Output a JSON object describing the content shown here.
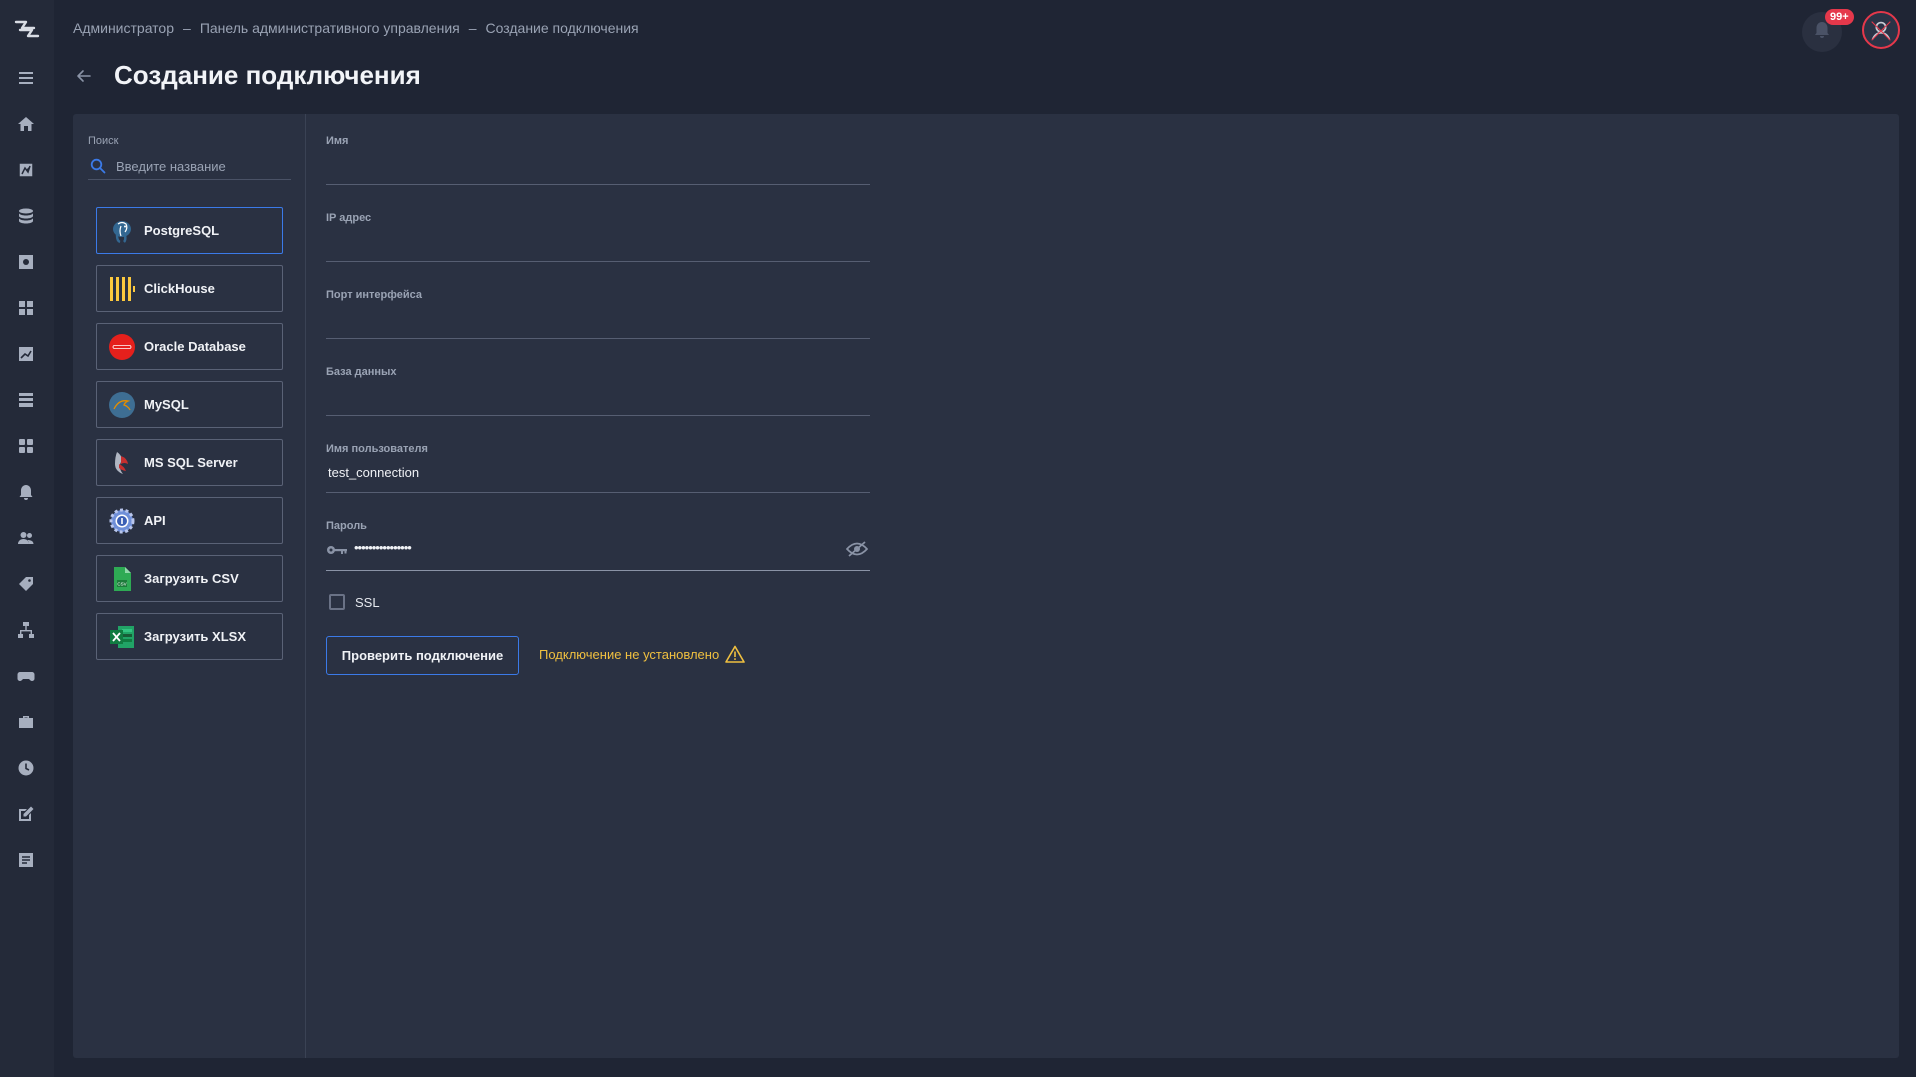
{
  "breadcrumb": [
    "Администратор",
    "Панель административного управления",
    "Создание подключения"
  ],
  "breadcrumb_sep": "–",
  "page_title": "Создание подключения",
  "notifications": {
    "badge": "99+"
  },
  "sidebar_icons": [
    "menu-icon",
    "home-icon",
    "analytics-icon",
    "database-icon",
    "settings-box-icon",
    "dashboard-icon",
    "chart-icon",
    "table-icon",
    "widgets-icon",
    "alert-icon",
    "users-icon",
    "tag-icon",
    "hierarchy-icon",
    "gamepad-icon",
    "briefcase-icon",
    "clock-icon",
    "edit-icon",
    "report-icon"
  ],
  "search": {
    "label": "Поиск",
    "placeholder": "Введите название"
  },
  "sources": [
    {
      "label": "PostgreSQL",
      "icon": "postgresql-icon",
      "active": true
    },
    {
      "label": "ClickHouse",
      "icon": "clickhouse-icon",
      "active": false
    },
    {
      "label": "Oracle Database",
      "icon": "oracle-icon",
      "active": false
    },
    {
      "label": "MySQL",
      "icon": "mysql-icon",
      "active": false
    },
    {
      "label": "MS SQL Server",
      "icon": "mssql-icon",
      "active": false
    },
    {
      "label": "API",
      "icon": "api-icon",
      "active": false
    },
    {
      "label": "Загрузить CSV",
      "icon": "csv-icon",
      "active": false
    },
    {
      "label": "Загрузить XLSX",
      "icon": "xlsx-icon",
      "active": false
    }
  ],
  "form": {
    "name": {
      "label": "Имя",
      "value": ""
    },
    "ip": {
      "label": "IP адрес",
      "value": ""
    },
    "port": {
      "label": "Порт интерфейса",
      "value": ""
    },
    "database": {
      "label": "База данных",
      "value": ""
    },
    "username": {
      "label": "Имя пользователя",
      "value": "test_connection"
    },
    "password": {
      "label": "Пароль",
      "value": "••••••••••••••••"
    },
    "ssl": {
      "label": "SSL",
      "checked": false
    }
  },
  "check_button": "Проверить подключение",
  "status_text": "Подключение не установлено",
  "colors": {
    "accent": "#3b7ae8",
    "warning": "#f0c040",
    "badge": "#e5384b"
  }
}
